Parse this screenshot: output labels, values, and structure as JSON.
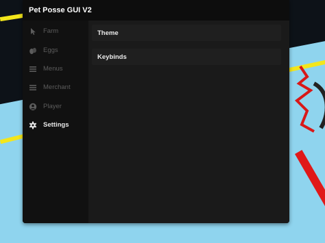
{
  "window": {
    "title": "Pet Posse GUI V2"
  },
  "sidebar": {
    "items": [
      {
        "label": "Farm",
        "icon": "cursor-icon",
        "active": false
      },
      {
        "label": "Eggs",
        "icon": "eggs-icon",
        "active": false
      },
      {
        "label": "Menus",
        "icon": "menu-icon",
        "active": false
      },
      {
        "label": "Merchant",
        "icon": "menu-icon",
        "active": false
      },
      {
        "label": "Player",
        "icon": "user-icon",
        "active": false
      },
      {
        "label": "Settings",
        "icon": "gear-icon",
        "active": true
      }
    ]
  },
  "content": {
    "sections": [
      {
        "label": "Theme"
      },
      {
        "label": "Keybinds"
      }
    ]
  },
  "colors": {
    "sky": "#8fd4ee",
    "window_bg": "#161616",
    "sidebar_bg": "#111111",
    "inactive_text": "#5c5c5c",
    "active_text": "#e8e8e8"
  }
}
